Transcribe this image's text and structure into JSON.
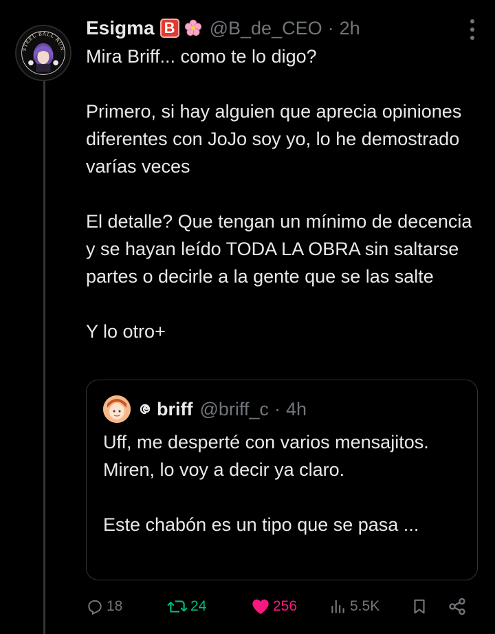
{
  "tweet": {
    "display_name": "Esigma",
    "badge_letter": "B",
    "handle": "@B_de_CEO",
    "separator": "·",
    "time": "2h",
    "avatar_text": "STEEL BALL RUN",
    "text": "Mira Briff... como te lo digo?\n\nPrimero, si hay alguien que aprecia opiniones diferentes con JoJo soy yo, lo he demostrado varías veces\n\nEl detalle? Que tengan un mínimo de decencia y se hayan leído TODA LA OBRA sin saltarse partes o decirle a la gente que se las salte\n\nY lo otro+"
  },
  "quoted": {
    "display_name": "briff",
    "handle": "@briff_c",
    "separator": "·",
    "time": "4h",
    "text": "Uff, me desperté con varios mensajitos.\nMiren, lo voy a decir ya claro.\n\nEste chabón es un tipo que se pasa ..."
  },
  "actions": {
    "replies": "18",
    "retweets": "24",
    "likes": "256",
    "views": "5.5K"
  },
  "colors": {
    "background": "#000000",
    "text": "#e7e9ea",
    "muted": "#71767b",
    "retweet": "#00ba7c",
    "like": "#f91880",
    "badge": "#e03b32"
  },
  "icons": [
    "more-icon",
    "reply-icon",
    "retweet-icon",
    "heart-icon",
    "views-icon",
    "bookmark-icon",
    "share-icon"
  ]
}
